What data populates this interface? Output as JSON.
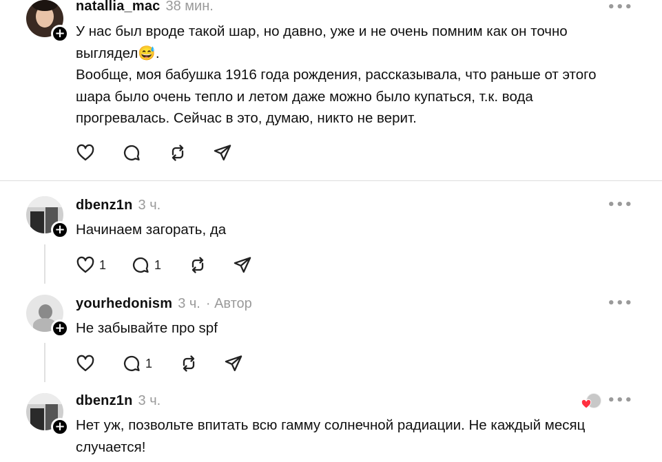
{
  "post1": {
    "username": "natallia_mac",
    "time": "38 мин.",
    "paragraphs": [
      "У нас был вроде такой шар, но давно, уже и не очень помним как он точно выглядел😅.",
      "Вообще, моя бабушка 1916 года рождения, рассказывала, что раньше от этого шара было очень тепло и летом даже можно было купаться, т.к. вода прогревалась. Сейчас в это, думаю, никто не верит."
    ],
    "more": "•••",
    "add": "+"
  },
  "reply1": {
    "username": "dbenz1n",
    "time": "3 ч.",
    "text": "Начинаем загорать, да",
    "likes": "1",
    "comments": "1",
    "more": "•••",
    "add": "+"
  },
  "reply2": {
    "username": "yourhedonism",
    "time": "3 ч.",
    "author_badge": "· Автор",
    "text": "Не забывайте про spf",
    "comments": "1",
    "more": "•••",
    "add": "+"
  },
  "reply3": {
    "username": "dbenz1n",
    "time": "3 ч.",
    "text": "Нет уж, позвольте впитать всю гамму солнечной радиации. Не каждый месяц случается!",
    "more": "•••",
    "add": "+"
  },
  "colors": {
    "text": "#101010",
    "muted": "#9a9a9a",
    "divider": "#dcdcdc",
    "heart_red": "#ff3040"
  },
  "icons": [
    "heart-icon",
    "comment-icon",
    "repost-icon",
    "share-icon",
    "plus-icon",
    "more-icon"
  ]
}
